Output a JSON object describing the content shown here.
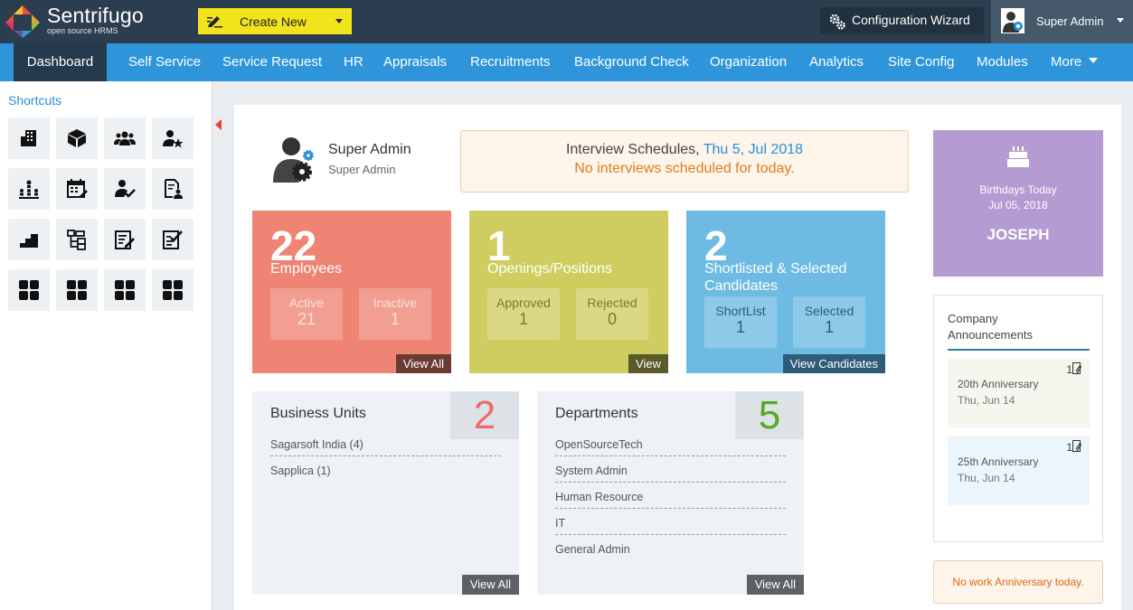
{
  "brand": {
    "name": "Sentrifugo",
    "tagline": "open source HRMS"
  },
  "topbar": {
    "create_label": "Create New",
    "config_label": "Configuration Wizard",
    "user_label": "Super Admin"
  },
  "nav": {
    "items": [
      "Dashboard",
      "Self Service",
      "Service Request",
      "HR",
      "Appraisals",
      "Recruitments",
      "Background Check",
      "Organization",
      "Analytics",
      "Site Config",
      "Modules",
      "More"
    ],
    "active": "Dashboard"
  },
  "shortcuts": {
    "title": "Shortcuts"
  },
  "profile": {
    "name": "Super Admin",
    "role": "Super Admin"
  },
  "interview": {
    "title": "Interview Schedules,",
    "date": "Thu 5, Jul 2018",
    "message": "No interviews scheduled for today."
  },
  "employees": {
    "count": "22",
    "label": "Employees",
    "active_label": "Active",
    "active_value": "21",
    "inactive_label": "Inactive",
    "inactive_value": "1",
    "link": "View All"
  },
  "openings": {
    "count": "1",
    "label": "Openings/Positions",
    "approved_label": "Approved",
    "approved_value": "1",
    "rejected_label": "Rejected",
    "rejected_value": "0",
    "link": "View"
  },
  "candidates": {
    "count": "2",
    "label_line1": "Shortlisted & Selected",
    "label_line2": "Candidates",
    "shortlist_label": "ShortList",
    "shortlist_value": "1",
    "selected_label": "Selected",
    "selected_value": "1",
    "link": "View Candidates"
  },
  "business_units": {
    "title": "Business Units",
    "count": "2",
    "items": [
      "Sagarsoft India (4)",
      "Sapplica (1)"
    ],
    "link": "View All"
  },
  "departments": {
    "title": "Departments",
    "count": "5",
    "items": [
      "OpenSourceTech",
      "System Admin",
      "Human Resource",
      "IT",
      "General Admin"
    ],
    "link": "View All"
  },
  "birthday": {
    "heading": "Birthdays Today",
    "date": "Jul 05, 2018",
    "name": "JOSEPH"
  },
  "announcements": {
    "title_line1": "Company",
    "title_line2": "Announcements",
    "items": [
      {
        "name": "20th Anniversary",
        "date": "Thu, Jun 14",
        "count": "1"
      },
      {
        "name": "25th Anniversary",
        "date": "Thu, Jun 14",
        "count": "1"
      }
    ]
  },
  "anniversary": {
    "message": "No work Anniversary today."
  },
  "colors": {
    "topbar": "#2b3d4f",
    "nav": "#2f95db",
    "create": "#f2e41c",
    "employees": "#ef8474",
    "openings": "#d0cd60",
    "candidates": "#6dbbe3",
    "birthday": "#b49bd1"
  }
}
